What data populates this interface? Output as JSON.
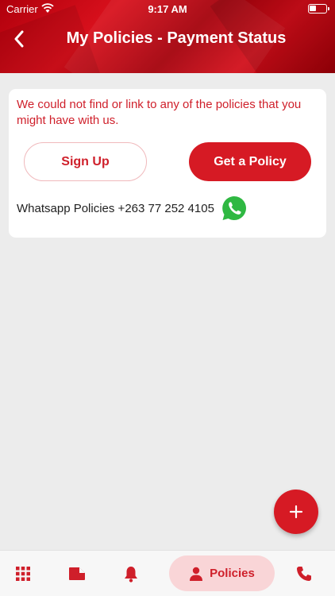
{
  "status_bar": {
    "carrier": "Carrier",
    "time": "9:17 AM"
  },
  "header": {
    "title": "My Policies - Payment Status",
    "back_icon": "chevron-left-icon"
  },
  "card": {
    "message": "We could not find or link to any of the policies that you might have with us.",
    "signup_label": "Sign Up",
    "get_policy_label": "Get a Policy",
    "whatsapp_text": "Whatsapp Policies +263 77 252 4105"
  },
  "fab": {
    "icon": "plus-icon"
  },
  "bottom_nav": {
    "items": [
      {
        "icon": "grid-icon"
      },
      {
        "icon": "folder-icon"
      },
      {
        "icon": "bell-icon"
      },
      {
        "icon": "person-icon",
        "label": "Policies",
        "active": true
      },
      {
        "icon": "phone-icon"
      }
    ]
  },
  "colors": {
    "brand_red": "#d61a24",
    "text_red": "#cf1f2a",
    "active_pill": "#f9d5d7",
    "whatsapp_green": "#2fb842"
  }
}
